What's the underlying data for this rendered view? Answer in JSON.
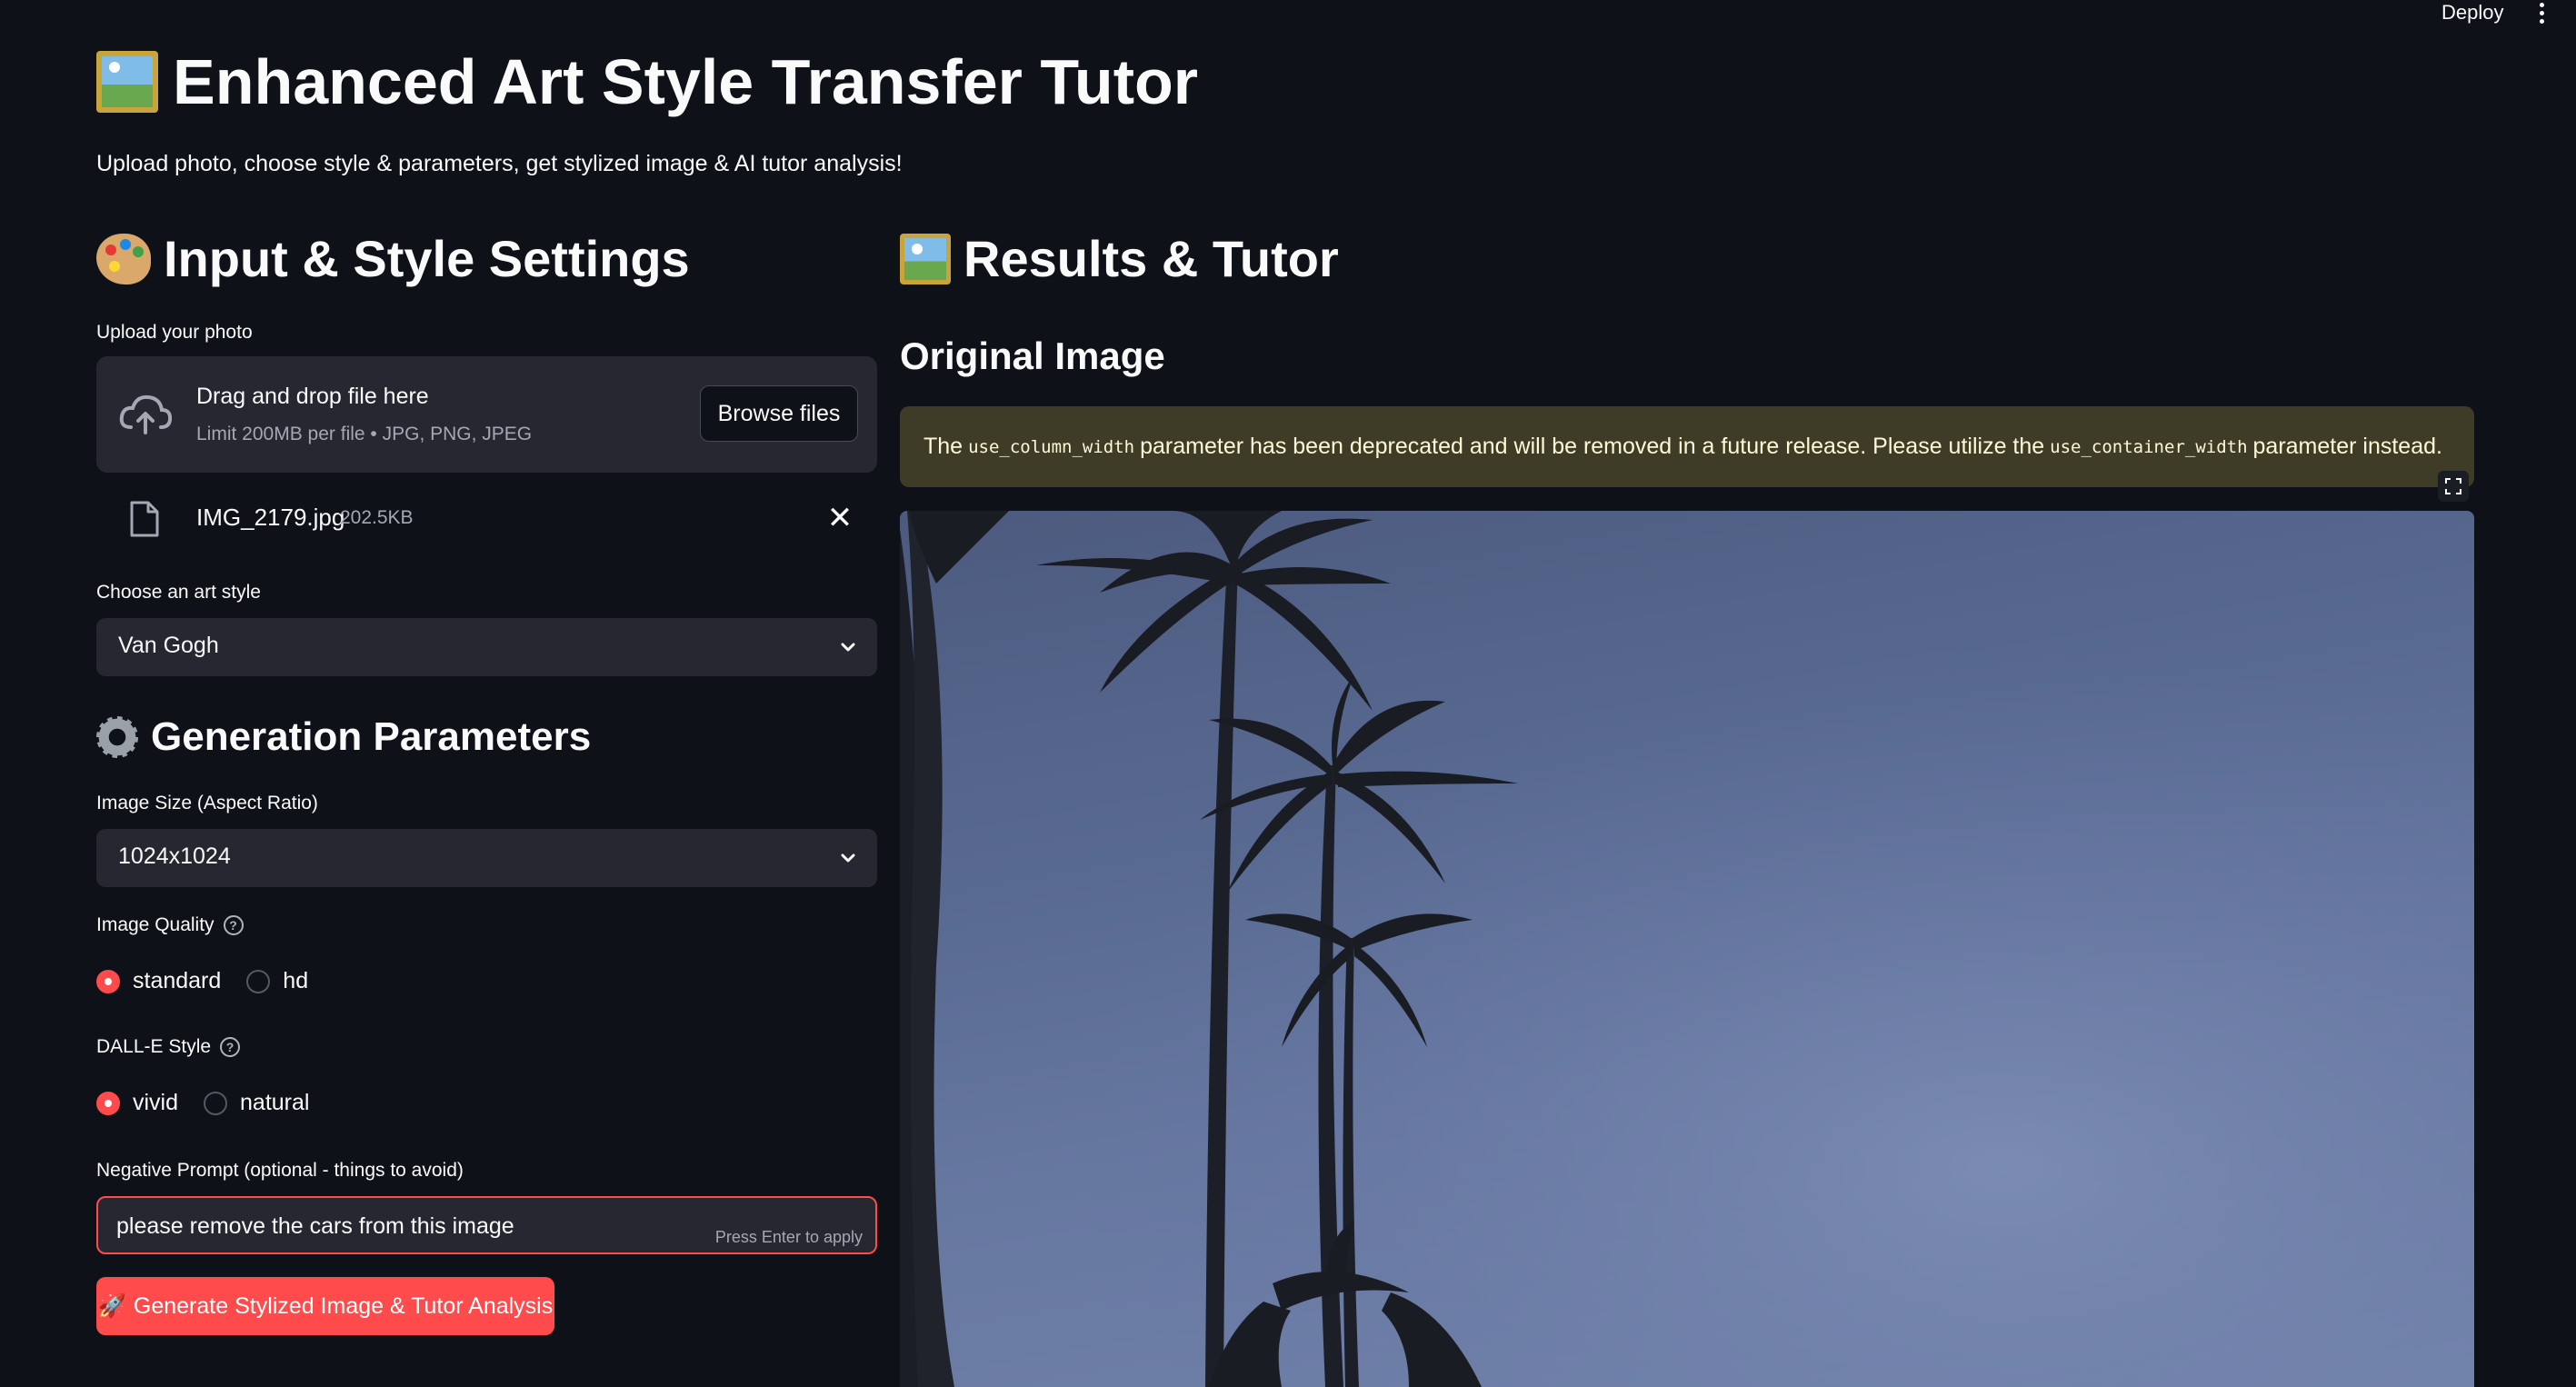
{
  "header": {
    "deploy_label": "Deploy",
    "menu_icon": "more-vertical-icon"
  },
  "page": {
    "title": "Enhanced Art Style Transfer Tutor",
    "subtitle": "Upload photo, choose style & parameters, get stylized image & AI tutor analysis!"
  },
  "left": {
    "heading": "Input & Style Settings",
    "upload": {
      "label": "Upload your photo",
      "drop_title": "Drag and drop file here",
      "drop_limits": "Limit 200MB per file • JPG, PNG, JPEG",
      "browse_label": "Browse files",
      "file_name": "IMG_2179.jpg",
      "file_size": "202.5KB"
    },
    "style": {
      "label": "Choose an art style",
      "value": "Van Gogh"
    },
    "params_heading": "Generation Parameters",
    "size": {
      "label": "Image Size (Aspect Ratio)",
      "value": "1024x1024"
    },
    "quality": {
      "label": "Image Quality",
      "options": [
        "standard",
        "hd"
      ],
      "selected": "standard"
    },
    "dalle_style": {
      "label": "DALL-E Style",
      "options": [
        "vivid",
        "natural"
      ],
      "selected": "vivid"
    },
    "negative": {
      "label": "Negative Prompt (optional - things to avoid)",
      "value": "please remove the cars from this image",
      "hint": "Press Enter to apply"
    },
    "generate_label": "Generate Stylized Image & Tutor Analysis"
  },
  "right": {
    "heading": "Results & Tutor",
    "subheading": "Original Image",
    "warning": {
      "text_1": "The",
      "code_1": "use_column_width",
      "text_2": "parameter has been deprecated and will be removed in a future release. Please utilize the",
      "code_2": "use_container_width",
      "text_3": "parameter instead."
    }
  },
  "colors": {
    "background": "#0e1117",
    "widget": "#262730",
    "accent": "#ff4b4b",
    "warning_bg": "#3e3b26"
  }
}
